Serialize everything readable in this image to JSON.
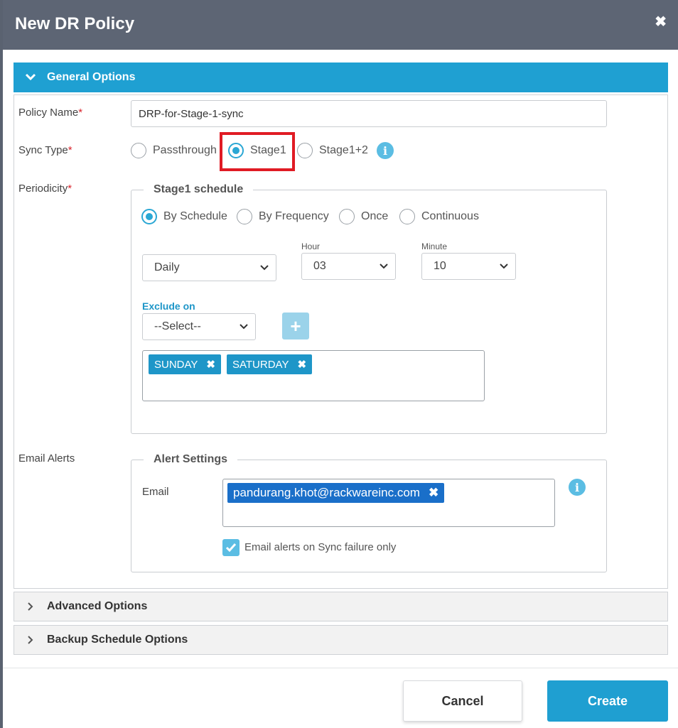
{
  "modal": {
    "title": "New DR Policy",
    "close_label": "✖"
  },
  "sections": {
    "general": "General Options",
    "advanced": "Advanced Options",
    "backup": "Backup Schedule Options"
  },
  "policy_name": {
    "label": "Policy Name",
    "required_mark": "*",
    "value": "DRP-for-Stage-1-sync"
  },
  "sync_type": {
    "label": "Sync Type",
    "required_mark": "*",
    "options": [
      "Passthrough",
      "Stage1",
      "Stage1+2"
    ],
    "selected": "Stage1",
    "info_icon": "i"
  },
  "periodicity": {
    "label": "Periodicity",
    "required_mark": "*",
    "group_title": "Stage1 schedule",
    "modes": [
      "By Schedule",
      "By Frequency",
      "Once",
      "Continuous"
    ],
    "selected_mode": "By Schedule",
    "frequency": "Daily",
    "hour_label": "Hour",
    "hour": "03",
    "minute_label": "Minute",
    "minute": "10",
    "exclude_label": "Exclude on",
    "exclude_select": "--Select--",
    "add_label": "+",
    "excluded_days": [
      "SUNDAY",
      "SATURDAY"
    ],
    "remove_label": "✖"
  },
  "email_alerts": {
    "label": "Email Alerts",
    "group_title": "Alert Settings",
    "email_label": "Email",
    "emails": [
      "pandurang.khot@rackwareinc.com"
    ],
    "remove_label": "✖",
    "info_icon": "i",
    "failure_only_label": "Email alerts on Sync failure only",
    "failure_only_checked": true
  },
  "footer": {
    "cancel": "Cancel",
    "create": "Create"
  },
  "colors": {
    "accent": "#1fa0d2",
    "header": "#5d6574",
    "highlight": "#e01b24"
  }
}
